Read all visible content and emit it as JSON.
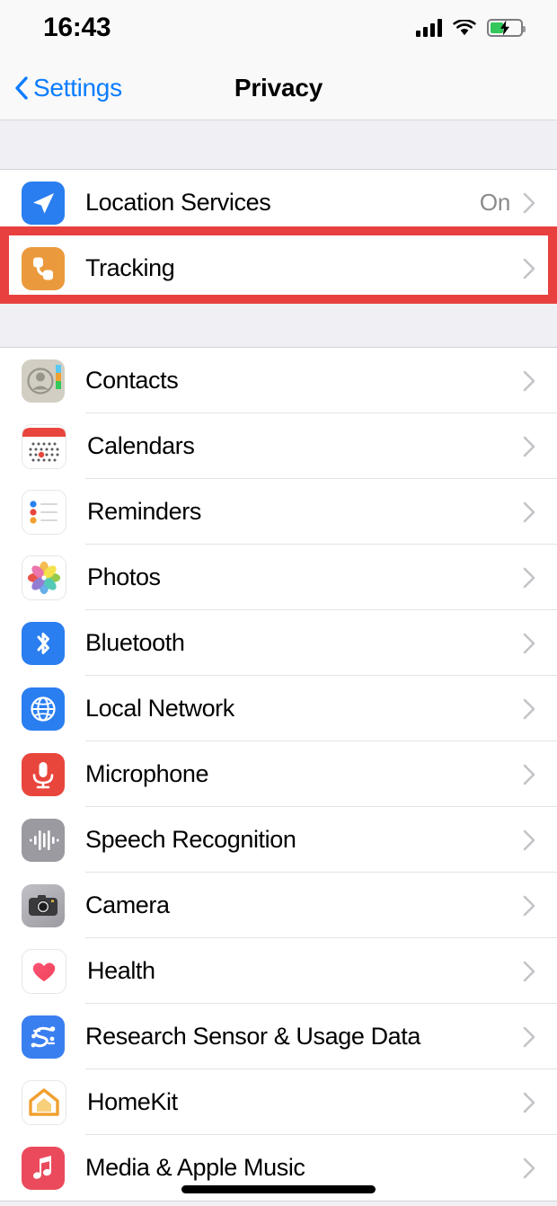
{
  "status_bar": {
    "time": "16:43",
    "signal_icon": "cellular-signal-icon",
    "wifi_icon": "wifi-icon",
    "battery_icon": "battery-charging-icon",
    "battery_level_percent": 45,
    "battery_fill_color": "#34c759"
  },
  "nav": {
    "back_label": "Settings",
    "back_icon": "chevron-left-icon",
    "title": "Privacy",
    "accent_color": "#0a7cff"
  },
  "annotation": {
    "type": "highlight-box",
    "color": "#e8403f",
    "target": "Tracking"
  },
  "sections": [
    {
      "rows": [
        {
          "label": "Location Services",
          "value": "On",
          "icon": "location-services-icon",
          "icon_color": "#2a7ef0"
        },
        {
          "label": "Tracking",
          "value": "",
          "icon": "tracking-icon",
          "icon_color": "#ea9a3c",
          "highlighted": true
        }
      ]
    },
    {
      "rows": [
        {
          "label": "Contacts",
          "value": "",
          "icon": "contacts-icon",
          "icon_color": "#d2cec3"
        },
        {
          "label": "Calendars",
          "value": "",
          "icon": "calendars-icon",
          "icon_color": "#ffffff"
        },
        {
          "label": "Reminders",
          "value": "",
          "icon": "reminders-icon",
          "icon_color": "#ffffff"
        },
        {
          "label": "Photos",
          "value": "",
          "icon": "photos-icon",
          "icon_color": "#ffffff"
        },
        {
          "label": "Bluetooth",
          "value": "",
          "icon": "bluetooth-icon",
          "icon_color": "#2a7ef0"
        },
        {
          "label": "Local Network",
          "value": "",
          "icon": "local-network-icon",
          "icon_color": "#2a7ef0"
        },
        {
          "label": "Microphone",
          "value": "",
          "icon": "microphone-icon",
          "icon_color": "#e8463c"
        },
        {
          "label": "Speech Recognition",
          "value": "",
          "icon": "speech-recognition-icon",
          "icon_color": "#9a9aa0"
        },
        {
          "label": "Camera",
          "value": "",
          "icon": "camera-icon",
          "icon_color": "#a8a8ad"
        },
        {
          "label": "Health",
          "value": "",
          "icon": "health-icon",
          "icon_color": "#ffffff"
        },
        {
          "label": "Research Sensor & Usage Data",
          "value": "",
          "icon": "research-sensor-icon",
          "icon_color": "#3a7ff0"
        },
        {
          "label": "HomeKit",
          "value": "",
          "icon": "homekit-icon",
          "icon_color": "#ffffff"
        },
        {
          "label": "Media & Apple Music",
          "value": "",
          "icon": "media-apple-music-icon",
          "icon_color": "#ea4a5c"
        }
      ]
    }
  ],
  "chevron_icon": "chevron-right-icon",
  "home_indicator": "home-indicator"
}
